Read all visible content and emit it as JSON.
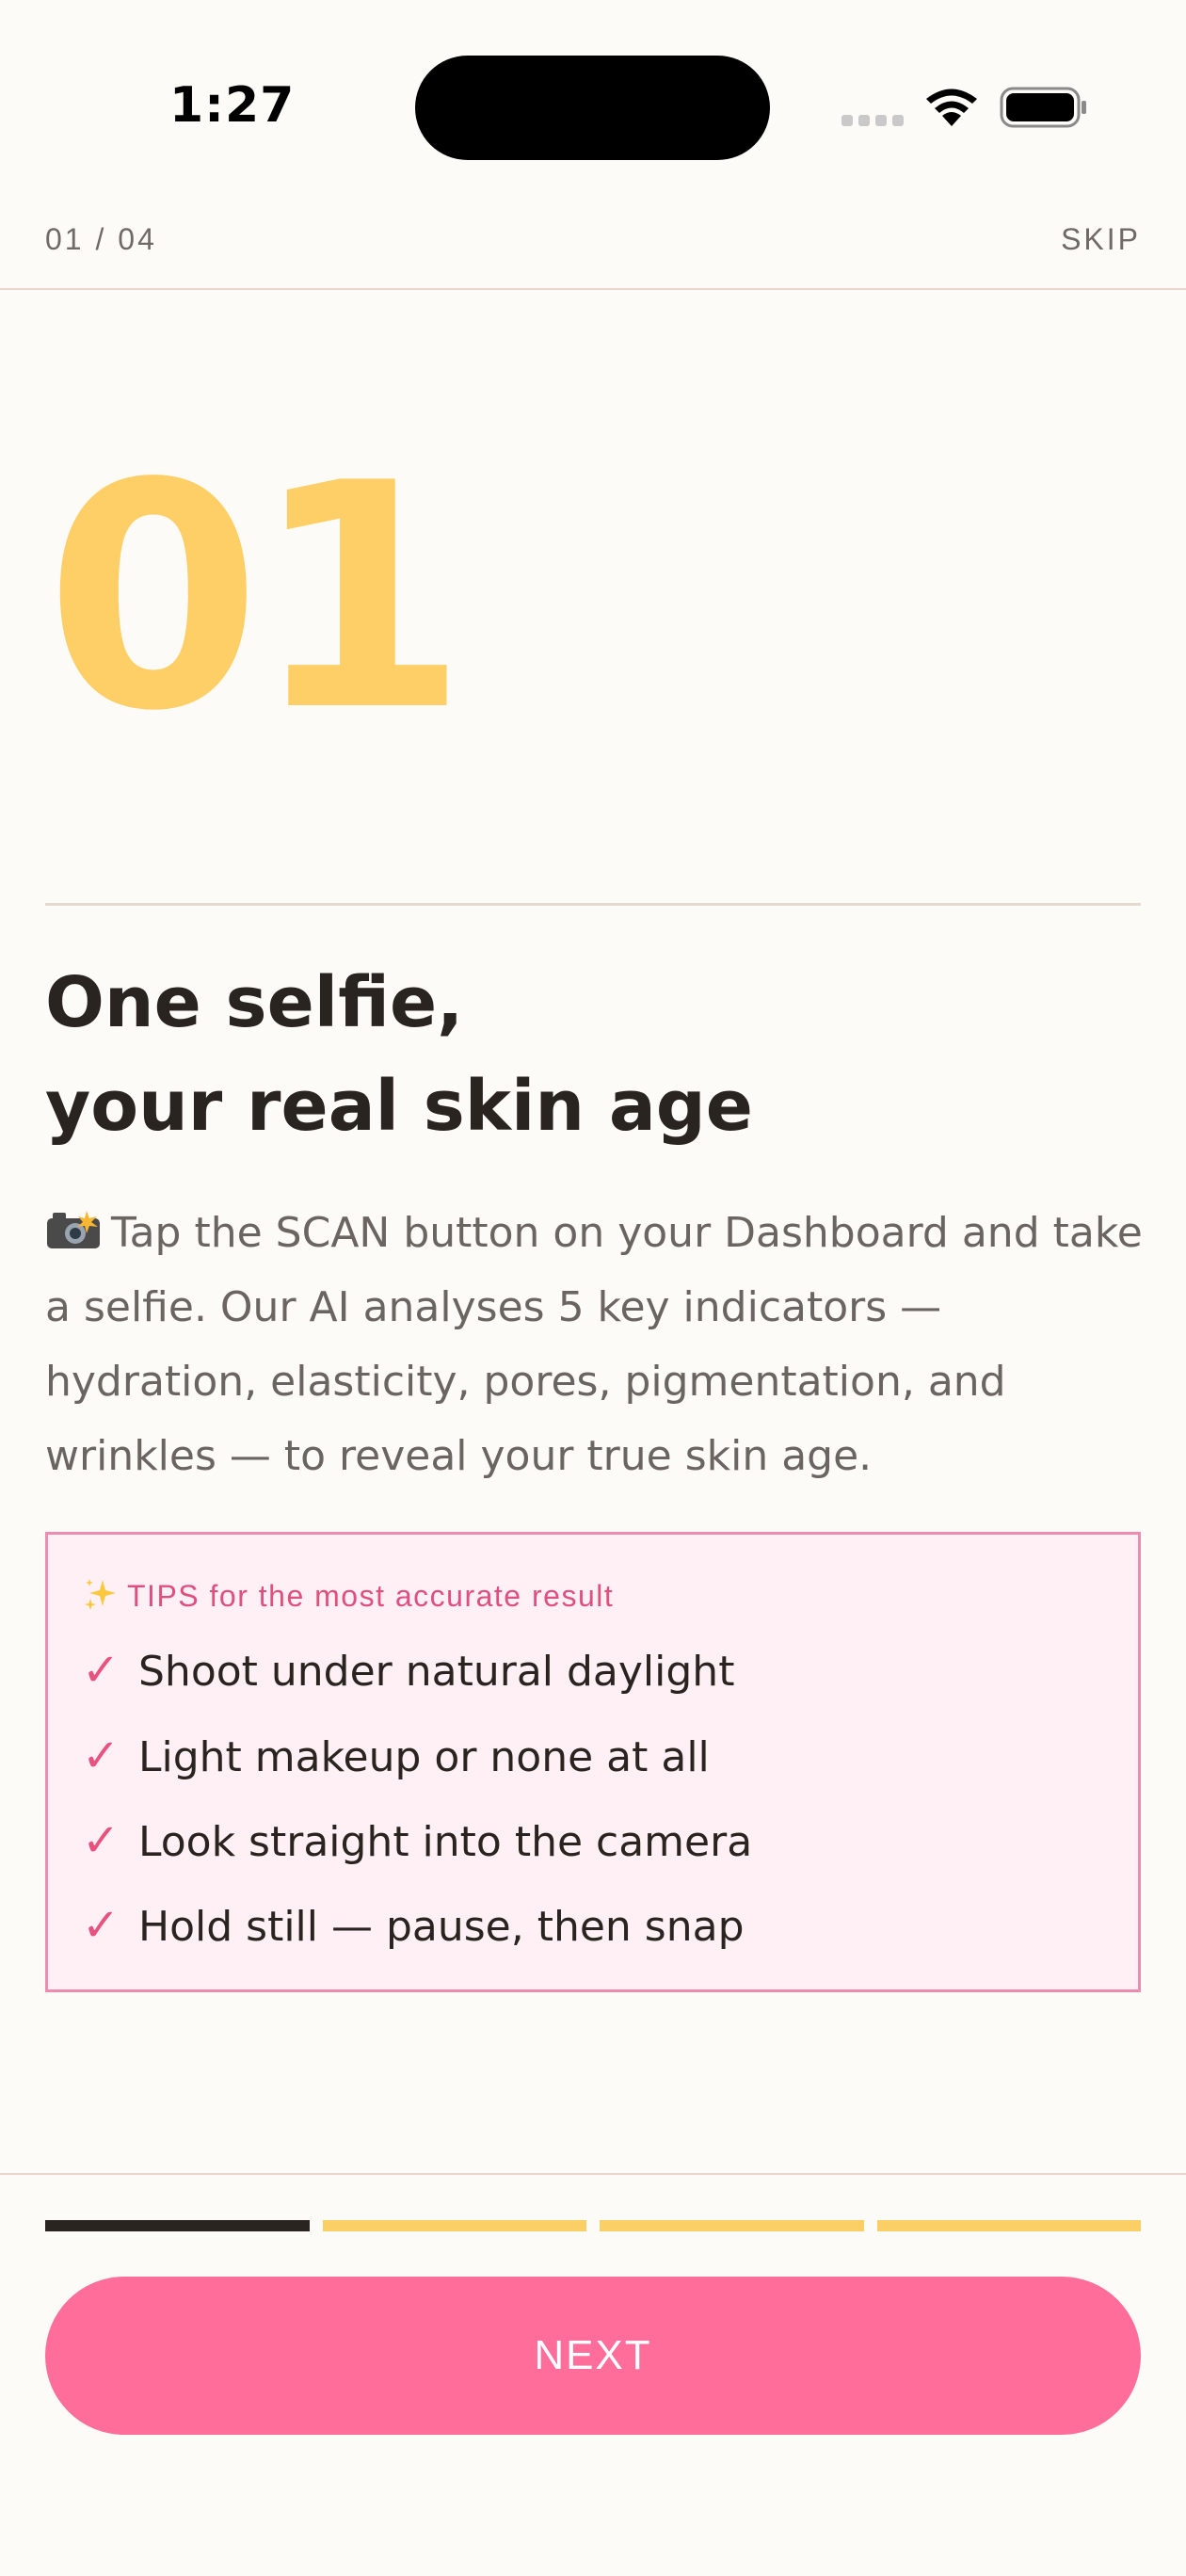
{
  "status_bar": {
    "time": "1:27"
  },
  "header": {
    "step_counter": "01 / 04",
    "skip_label": "SKIP"
  },
  "slide": {
    "number": "01",
    "title_line1": "One selfie,",
    "title_line2": "your real skin age",
    "description": "Tap the SCAN button on your Dashboard and take a selfie. Our AI analyses 5 key indicators — hydration, elasticity, pores, pigmentation, and wrinkles — to reveal your true skin age.",
    "description_icon": "camera-flash-icon"
  },
  "tips": {
    "header": "TIPS for the most accurate result",
    "header_icon": "sparkles-icon",
    "items": [
      "Shoot under natural daylight",
      "Light makeup or none at all",
      "Look straight into the camera",
      "Hold still — pause, then snap"
    ]
  },
  "progress": {
    "current_step": 1,
    "total_steps": 4
  },
  "footer": {
    "next_label": "NEXT"
  },
  "colors": {
    "background": "#fdfbf7",
    "accent_pink": "#ff6d9b",
    "number_yellow": "#fecf67",
    "progress_active": "#2a2420",
    "progress_inactive": "#fbcf66",
    "tips_background": "#fff0f5",
    "tips_border": "#f08bb0"
  }
}
